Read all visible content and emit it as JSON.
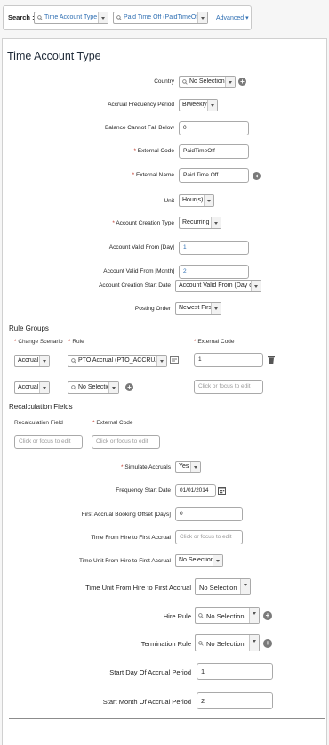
{
  "search": {
    "label": "Search :",
    "object_type": "Time Account Type",
    "record": "Paid Time Off (PaidTimeOff)",
    "advanced": "Advanced ▾"
  },
  "title": "Time Account Type",
  "fields": {
    "country": {
      "label": "Country",
      "value": "No Selection"
    },
    "accrual_freq": {
      "label": "Accrual Frequency Period",
      "value": "Biweekly"
    },
    "balance": {
      "label": "Balance Cannot Fall Below",
      "value": "0"
    },
    "ext_code": {
      "label": "External Code",
      "value": "PaidTimeOff"
    },
    "ext_name": {
      "label": "External Name",
      "value": "Paid Time Off"
    },
    "unit": {
      "label": "Unit",
      "value": "Hour(s)"
    },
    "creation_type": {
      "label": "Account Creation Type",
      "value": "Recurring"
    },
    "valid_day": {
      "label": "Account Valid From [Day]",
      "value": "1"
    },
    "valid_month": {
      "label": "Account Valid From [Month]",
      "value": "2"
    },
    "start_date": {
      "label": "Account Creation Start Date",
      "value": "Account Valid From (Day o..."
    },
    "posting_order": {
      "label": "Posting Order",
      "value": "Newest First"
    }
  },
  "rule_groups": {
    "title": "Rule Groups",
    "col_change": "Change Scenario",
    "col_rule": "Rule",
    "col_ext": "External Code",
    "rows": [
      {
        "change": "Accrual",
        "rule": "PTO Accrual (PTO_ACCRUAL)",
        "ext": "1"
      },
      {
        "change": "Accrual",
        "rule": "No Selection",
        "ext": "Click or focus to edit"
      }
    ]
  },
  "recalc": {
    "title": "Recalculation Fields",
    "col_field": "Recalculation Field",
    "col_ext": "External Code",
    "field_placeholder": "Click or focus to edit",
    "ext_placeholder": "Click or focus to edit"
  },
  "fields2": {
    "simulate": {
      "label": "Simulate Accruals",
      "value": "Yes"
    },
    "freq_start": {
      "label": "Frequency Start Date",
      "value": "01/01/2014"
    },
    "first_offset": {
      "label": "First Accrual Booking Offset [Days]",
      "value": "0"
    },
    "hire_to_first": {
      "label": "Time From Hire to First Accrual",
      "value": "Click or focus to edit"
    },
    "unit_hire_small": {
      "label": "Time Unit From Hire to First Accrual",
      "value": "No Selection"
    },
    "unit_hire_big": {
      "label": "Time Unit From Hire to First Accrual",
      "value": "No Selection"
    },
    "hire_rule": {
      "label": "Hire Rule",
      "value": "No Selection"
    },
    "term_rule": {
      "label": "Termination Rule",
      "value": "No Selection"
    },
    "start_day": {
      "label": "Start Day Of Accrual Period",
      "value": "1"
    },
    "start_month": {
      "label": "Start Month Of Accrual Period",
      "value": "2"
    }
  },
  "icons": [
    "search-icon",
    "add-icon",
    "info-icon",
    "trash-icon",
    "calendar-icon",
    "chevron-down-icon",
    "info-badge-icon"
  ]
}
